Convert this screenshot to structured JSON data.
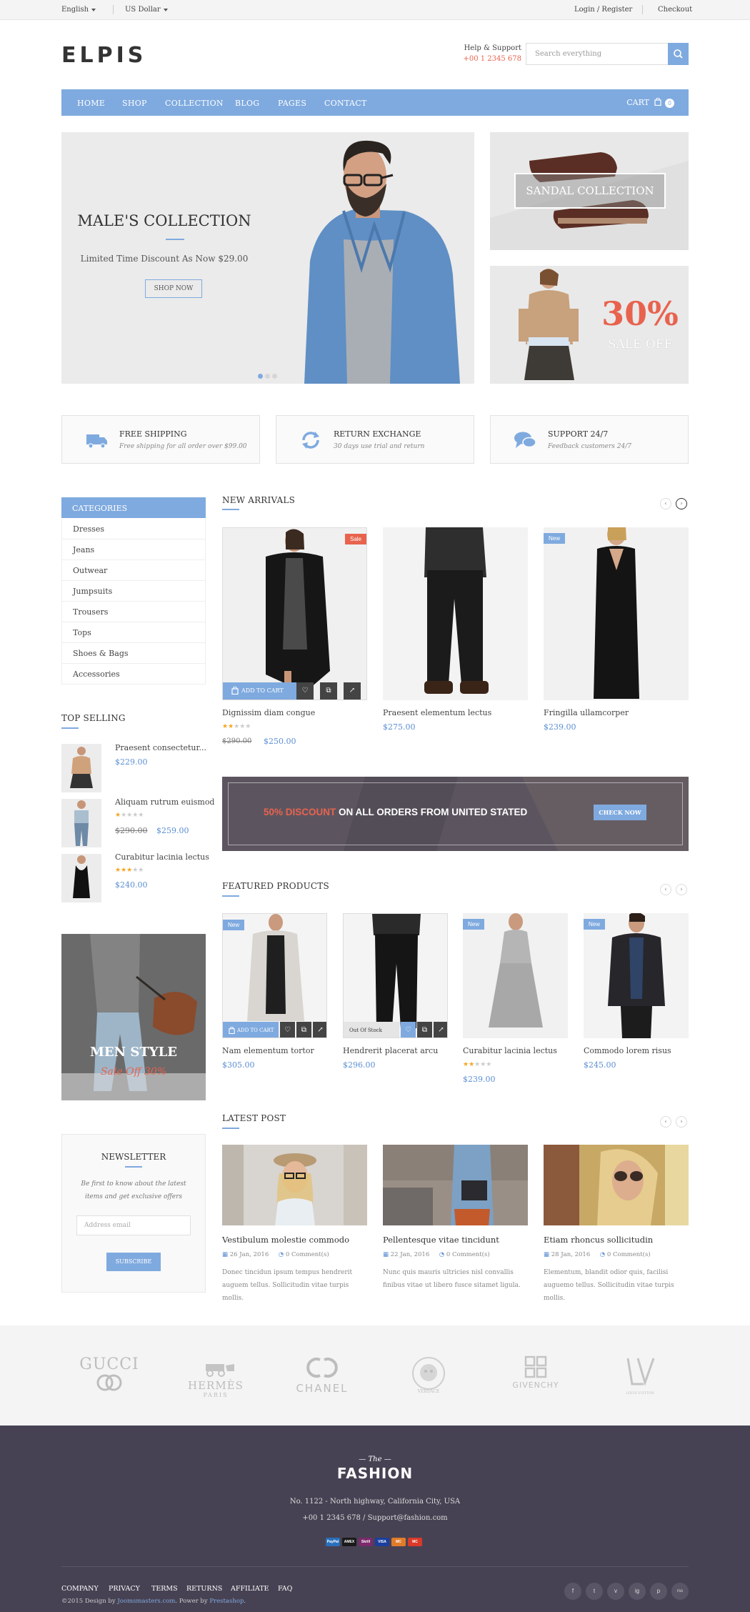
{
  "topbar": {
    "language": "English",
    "currency": "US Dollar",
    "login": "Login / Register",
    "checkout": "Checkout"
  },
  "header": {
    "logo": "ELPIS",
    "help_label": "Help & Support",
    "phone": "+00 1 2345 678",
    "search_placeholder": "Search everything"
  },
  "nav": {
    "items": [
      "HOME",
      "SHOP",
      "COLLECTION",
      "BLOG",
      "PAGES",
      "CONTACT"
    ],
    "cart_label": "CART",
    "cart_count": "0"
  },
  "hero": {
    "title": "MALE'S COLLECTION",
    "subtitle": "Limited Time Discount As Now $29.00",
    "button": "SHOP NOW",
    "active_slide": 1,
    "slides": 3
  },
  "side_banners": {
    "sandal": "SANDAL COLLECTION",
    "sale_pct": "30%",
    "sale_off": "SALE OFF"
  },
  "features": [
    {
      "title": "FREE SHIPPING",
      "sub": "Free shipping for all order over $99.00",
      "icon": "truck-icon"
    },
    {
      "title": "RETURN EXCHANGE",
      "sub": "30 days use trial and return",
      "icon": "refresh-icon"
    },
    {
      "title": "SUPPORT 24/7",
      "sub": "Feedback customers 24/7",
      "icon": "chat-icon"
    }
  ],
  "categories": {
    "title": "CATEGORIES",
    "items": [
      "Dresses",
      "Jeans",
      "Outwear",
      "Jumpsuits",
      "Trousers",
      "Tops",
      "Shoes & Bags",
      "Accessories"
    ]
  },
  "top_selling": {
    "title": "TOP SELLING",
    "items": [
      {
        "name": "Praesent consectetur...",
        "price": "$229.00",
        "old": "",
        "rating": 0
      },
      {
        "name": "Aliquam rutrum euismod",
        "price": "$259.00",
        "old": "$290.00",
        "rating": 1
      },
      {
        "name": "Curabitur lacinia lectus",
        "price": "$240.00",
        "old": "",
        "rating": 3
      }
    ]
  },
  "men_style": {
    "title": "MEN STYLE",
    "sub": "Sale Off 30%"
  },
  "newsletter": {
    "title": "NEWSLETTER",
    "desc": "Be first to know about the latest items and get exclusive offers",
    "placeholder": "Address email",
    "button": "SUBSCRIBE"
  },
  "new_arrivals": {
    "title": "NEW ARRIVALS",
    "add_to_cart": "ADD TO CART",
    "products": [
      {
        "name": "Dignissim diam congue",
        "price": "$250.00",
        "old": "$290.00",
        "badge": "Sale",
        "rating": 2
      },
      {
        "name": "Praesent elementum lectus",
        "price": "$275.00",
        "old": "",
        "badge": "",
        "rating": 0
      },
      {
        "name": "Fringilla ullamcorper",
        "price": "$239.00",
        "old": "",
        "badge": "New",
        "rating": 0
      }
    ]
  },
  "promo": {
    "highlight": "50% DISCOUNT",
    "text": " ON ALL ORDERS FROM UNITED STATED",
    "button": "CHECK NOW"
  },
  "featured": {
    "title": "FEATURED PRODUCTS",
    "add_to_cart": "ADD TO CART",
    "out_of_stock": "Out Of Stock",
    "products": [
      {
        "name": "Nam elementum tortor",
        "price": "$305.00",
        "badge": "New",
        "rating": 0
      },
      {
        "name": "Hendrerit placerat arcu",
        "price": "$296.00",
        "badge": "",
        "rating": 0
      },
      {
        "name": "Curabitur lacinia lectus",
        "price": "$239.00",
        "badge": "New",
        "rating": 2
      },
      {
        "name": "Commodo lorem risus",
        "price": "$245.00",
        "badge": "New",
        "rating": 0
      }
    ]
  },
  "latest_post": {
    "title": "LATEST POST",
    "posts": [
      {
        "title": "Vestibulum molestie commodo",
        "date": "26 Jan, 2016",
        "comments": "0 Comment(s)",
        "excerpt": "Donec tincidun ipsum tempus hendrerit auguem tellus. Sollicitudin vitae turpis mollis."
      },
      {
        "title": "Pellentesque vitae tincidunt",
        "date": "22 Jan, 2016",
        "comments": "0 Comment(s)",
        "excerpt": "Nunc quis mauris ultricies nisl convallis finibus vitae ut libero fusce sitamet ligula."
      },
      {
        "title": "Etiam rhoncus sollicitudin",
        "date": "28 Jan, 2016",
        "comments": "0 Comment(s)",
        "excerpt": "Elementum, blandit odior quis, facilisi auguemo tellus. Sollicitudin vitae turpis mollis."
      }
    ]
  },
  "brands": {
    "gucci": "GUCCI",
    "hermes": "HERMÈS",
    "hermes_sub": "PARIS",
    "chanel": "CHANEL",
    "versace": "VERSACE",
    "givenchy": "GIVENCHY",
    "lv_sub": "LOUIS VUITTON"
  },
  "footer": {
    "the": "The",
    "logo": "FASHION",
    "address": "No. 1122 - North highway, California City, USA",
    "contact": "+00 1 2345 678 / Support@fashion.com",
    "payments": [
      "PayPal",
      "AMEX",
      "Skrill",
      "VISA",
      "MC",
      "MC"
    ],
    "links": [
      "COMPANY",
      "PRIVACY",
      "TERMS",
      "RETURNS",
      "AFFILIATE",
      "FAQ"
    ],
    "copy_pre": "©2015 Design by ",
    "copy_a": "Joomsmasters.com",
    "copy_mid": ". Power by ",
    "copy_b": "Prestashop",
    "copy_end": ".",
    "social": [
      "f",
      "t",
      "v",
      "ig",
      "p",
      "rss"
    ]
  },
  "colors": {
    "accent": "#7faadf",
    "sale": "#e8634e",
    "footer": "#474253"
  }
}
